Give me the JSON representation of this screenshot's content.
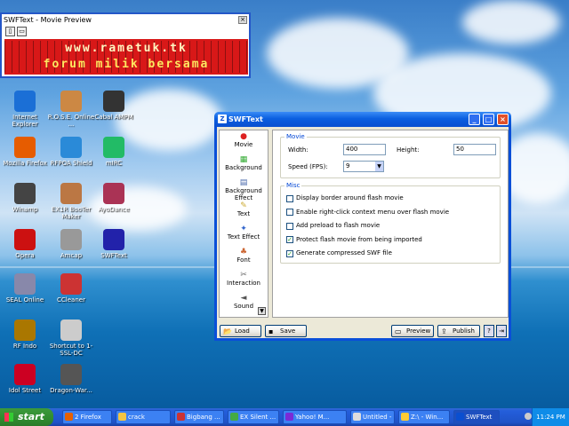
{
  "desktop": {
    "icons": [
      {
        "label": "Internet Explorer",
        "icon": "ie-icon"
      },
      {
        "label": "R.O.S.E. Online ...",
        "icon": "game-icon"
      },
      {
        "label": "Cabal AMPM",
        "icon": "cabal-icon"
      },
      {
        "label": "Mozilla Firefox",
        "icon": "firefox-icon"
      },
      {
        "label": "RFPOA Shield",
        "icon": "shield-icon"
      },
      {
        "label": "mIRC",
        "icon": "mirc-icon"
      },
      {
        "label": "Winamp",
        "icon": "winamp-icon"
      },
      {
        "label": "EX1R BooTer Maker",
        "icon": "app-icon"
      },
      {
        "label": "AyoDance",
        "icon": "ayodance-icon"
      },
      {
        "label": "Opera",
        "icon": "opera-icon"
      },
      {
        "label": "Amcap",
        "icon": "amcap-icon"
      },
      {
        "label": "SWFText",
        "icon": "swftext-icon"
      },
      {
        "label": "SEAL Online",
        "icon": "seal-icon"
      },
      {
        "label": "CCleaner",
        "icon": "ccleaner-icon"
      },
      {
        "label": "RF Indo",
        "icon": "rf-icon"
      },
      {
        "label": "Shortcut to 1-SSL-DC",
        "icon": "shortcut-icon"
      },
      {
        "label": "Idol Street",
        "icon": "idol-icon"
      },
      {
        "label": "Dragon-War...",
        "icon": "dragon-icon"
      }
    ]
  },
  "preview": {
    "title": "SWFText - Movie Preview",
    "close": "×",
    "line1": "www.rametuk.tk",
    "line2": "forum milik bersama"
  },
  "window": {
    "title": "SWFText",
    "minimize": "_",
    "maximize": "□",
    "close": "×",
    "nav": [
      {
        "label": "Movie",
        "icon": "movie-icon",
        "glyph": "●"
      },
      {
        "label": "Background",
        "icon": "background-icon",
        "glyph": "▦"
      },
      {
        "label": "Background Effect",
        "icon": "background-effect-icon",
        "glyph": "▤"
      },
      {
        "label": "Text",
        "icon": "text-icon",
        "glyph": "✎"
      },
      {
        "label": "Text Effect",
        "icon": "text-effect-icon",
        "glyph": "✦"
      },
      {
        "label": "Font",
        "icon": "font-icon",
        "glyph": "♣"
      },
      {
        "label": "Interaction",
        "icon": "interaction-icon",
        "glyph": "✂"
      },
      {
        "label": "Sound",
        "icon": "sound-icon",
        "glyph": "◄"
      }
    ],
    "movie_group": "Movie",
    "width_label": "Width:",
    "width_value": "400",
    "height_label": "Height:",
    "height_value": "50",
    "speed_label": "Speed (FPS):",
    "speed_value": "9",
    "misc_group": "Misc",
    "options": [
      {
        "label": "Display border around flash movie",
        "checked": false
      },
      {
        "label": "Enable right-click context menu over flash movie",
        "checked": false
      },
      {
        "label": "Add preload to flash movie",
        "checked": false
      },
      {
        "label": "Protect flash movie from being imported",
        "checked": true
      },
      {
        "label": "Generate compressed SWF file",
        "checked": true
      }
    ],
    "load": "Load",
    "save": "Save",
    "preview": "Preview",
    "publish": "Publish",
    "help": "?"
  },
  "taskbar": {
    "start": "start",
    "tasks": [
      {
        "label": "2 Firefox",
        "color": "#e66000"
      },
      {
        "label": "crack",
        "color": "#f4c542"
      },
      {
        "label": "Bigbang ...",
        "color": "#c33"
      },
      {
        "label": "EX Silent ...",
        "color": "#4a4"
      },
      {
        "label": "Yahoo! M...",
        "color": "#7b2ad6"
      },
      {
        "label": "Untitled - ...",
        "color": "#ddd"
      },
      {
        "label": "Z:\\ - Win...",
        "color": "#fc3"
      },
      {
        "label": "SWFText",
        "color": "#0a4fd0"
      }
    ],
    "clock": "11:24 PM"
  }
}
